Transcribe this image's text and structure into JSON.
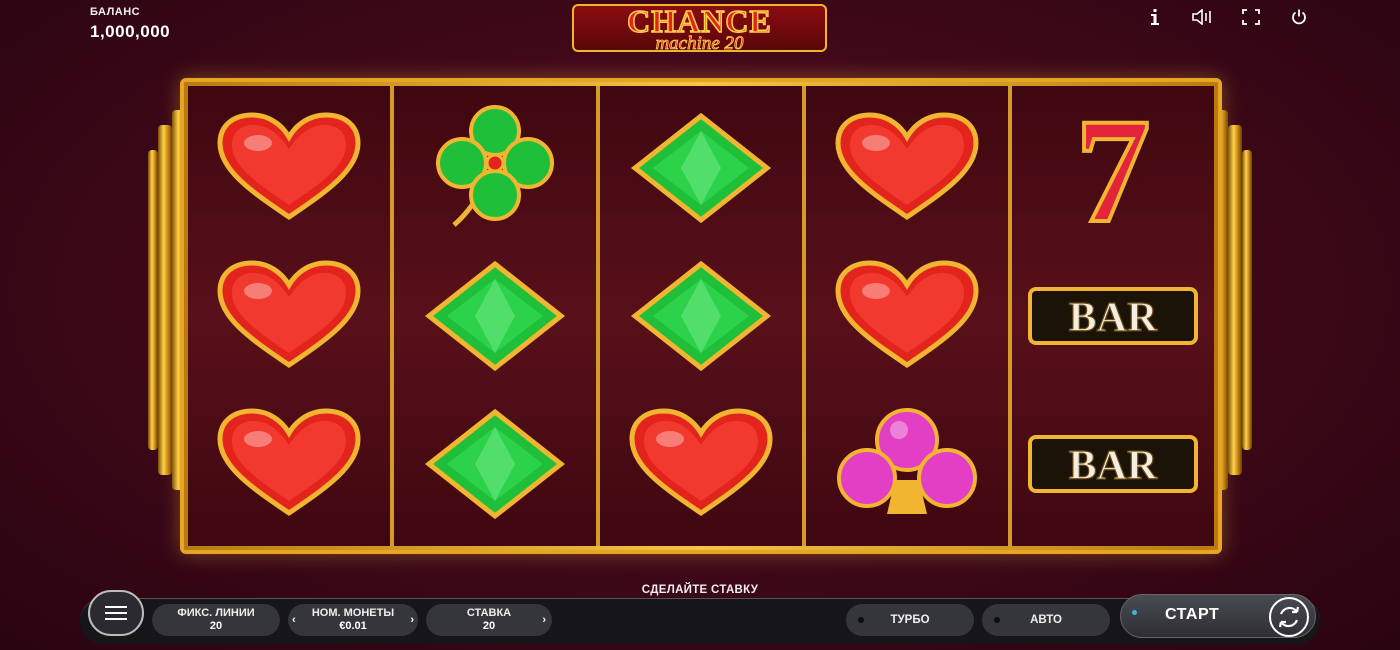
{
  "header": {
    "balance_label": "БАЛАНС",
    "balance_value": "1,000,000",
    "logo_main": "CHANCE",
    "logo_sub": "machine 20",
    "icons": [
      "info-icon",
      "sound-icon",
      "fullscreen-icon",
      "power-icon"
    ]
  },
  "reels": [
    [
      "heart",
      "heart",
      "heart"
    ],
    [
      "clover",
      "diamond",
      "diamond"
    ],
    [
      "diamond",
      "diamond",
      "heart"
    ],
    [
      "heart",
      "heart",
      "club"
    ],
    [
      "seven",
      "bar",
      "bar"
    ]
  ],
  "symbols": {
    "bar_text": "BAR",
    "seven_text": "7"
  },
  "colors": {
    "heart": "#e3241d",
    "diamond": "#1fbf3a",
    "club": "#e23fc4",
    "gold": "#f2b531",
    "seven": "#e3243a"
  },
  "footer": {
    "prompt": "СДЕЛАЙТЕ СТАВКУ",
    "lines_label": "ФИКС. ЛИНИИ",
    "lines_value": "20",
    "coin_label": "НОМ. МОНЕТЫ",
    "coin_value": "€0.01",
    "bet_label": "СТАВКА",
    "bet_value": "20",
    "turbo_label": "ТУРБО",
    "auto_label": "АВТО",
    "start_label": "СТАРТ"
  }
}
